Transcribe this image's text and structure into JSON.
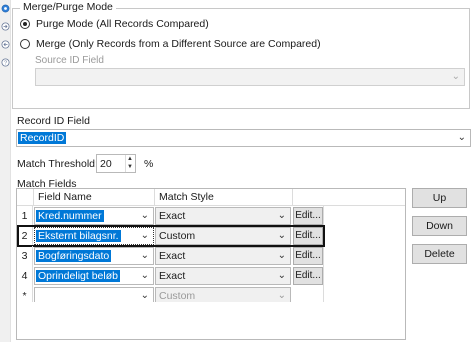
{
  "merge_purge": {
    "group_label": "Merge/Purge Mode",
    "purge_mode_label": "Purge Mode (All Records Compared)",
    "merge_mode_label": "Merge (Only Records from a Different Source are Compared)",
    "source_id_label": "Source ID Field",
    "source_id_value": ""
  },
  "record_id": {
    "label": "Record ID Field",
    "value": "RecordID"
  },
  "threshold": {
    "label": "Match Threshold:",
    "value": "20",
    "unit": "%"
  },
  "match_fields": {
    "label": "Match Fields",
    "columns": [
      "Field Name",
      "Match Style"
    ],
    "rows": [
      {
        "num": "1",
        "field": "Kred.nummer",
        "style": "Exact",
        "edit": "Edit..."
      },
      {
        "num": "2",
        "field": "Eksternt bilagsnr.",
        "style": "Custom",
        "edit": "Edit..."
      },
      {
        "num": "3",
        "field": "Bogføringsdato",
        "style": "Exact",
        "edit": "Edit..."
      },
      {
        "num": "4",
        "field": "Oprindeligt beløb",
        "style": "Exact",
        "edit": "Edit..."
      }
    ],
    "new_row": {
      "marker": "*",
      "field": "",
      "style": "Custom"
    }
  },
  "buttons": {
    "up": "Up",
    "down": "Down",
    "delete": "Delete"
  },
  "colors": {
    "selection": "#0078d7",
    "button_face": "#e1e1e1"
  },
  "icons": [
    "gear-icon",
    "arrow-in-icon",
    "arrow-out-icon",
    "help-icon"
  ]
}
